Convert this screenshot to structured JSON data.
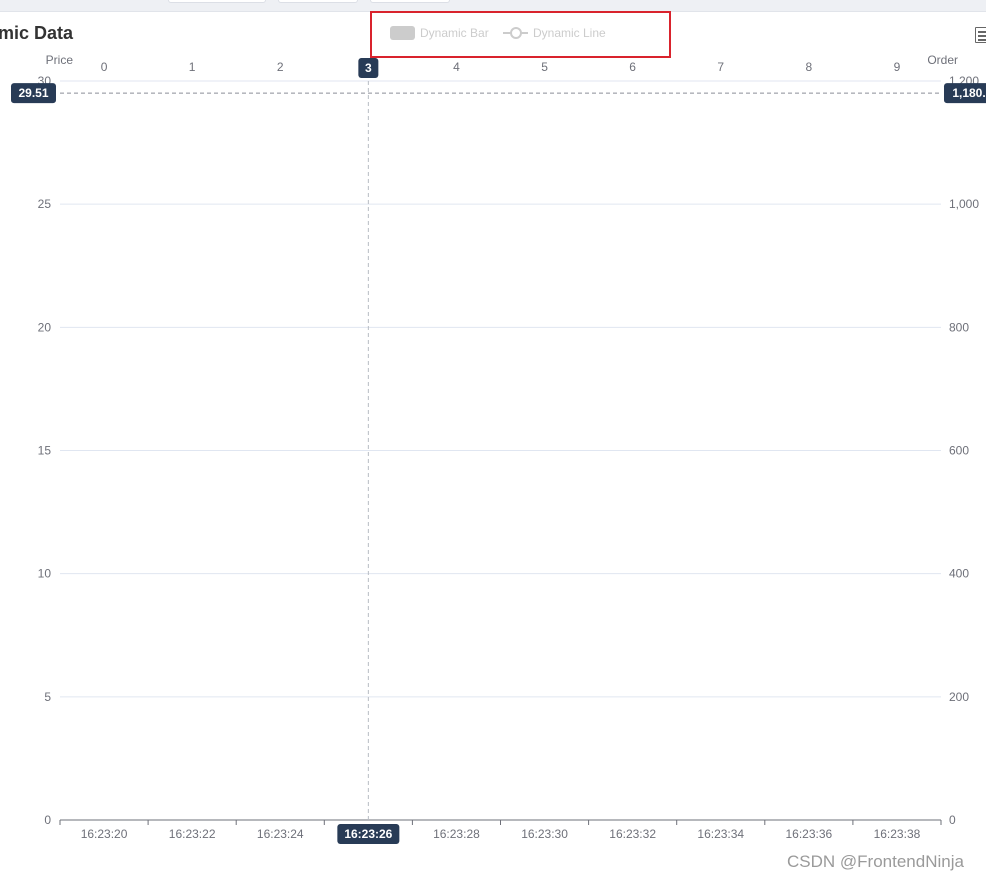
{
  "page": {
    "title": "mic Data",
    "watermark": "CSDN @FrontendNinja"
  },
  "legend": {
    "items": [
      {
        "label": "Dynamic Bar",
        "icon": "bar-swatch-icon",
        "state": "inactive"
      },
      {
        "label": "Dynamic Line",
        "icon": "line-swatch-icon",
        "state": "inactive"
      }
    ]
  },
  "toolbox": {
    "icon": "data-view-icon"
  },
  "colors": {
    "axis_label": "#6e7079",
    "grid": "#e0e6f1",
    "axis_line": "#6e7079",
    "pointer_label_bg": "#283b56",
    "pointer_label_text": "#ffffff",
    "pointer_line": "#b8bcc4",
    "legend_inactive": "#cccccc",
    "highlight": "#d9232d"
  },
  "chart_data": {
    "type": "bar",
    "x_time": {
      "position": "bottom",
      "categories": [
        "16:23:20",
        "16:23:22",
        "16:23:24",
        "16:23:26",
        "16:23:28",
        "16:23:30",
        "16:23:32",
        "16:23:34",
        "16:23:36",
        "16:23:38"
      ],
      "visible_labels": [
        "16:23:20",
        "16:23:22",
        "16:23:24",
        "16:23:2",
        "16:23:28",
        "16:23:30",
        "16:23:32",
        "16:23:34",
        "16:23:36",
        "16:23:38"
      ],
      "pointer_label": "16:23:26"
    },
    "x_index": {
      "position": "top",
      "categories": [
        "0",
        "1",
        "2",
        "3",
        "4",
        "5",
        "6",
        "7",
        "8",
        "9"
      ],
      "pointer_label": "3"
    },
    "y_left": {
      "name": "Price",
      "min": 0,
      "max": 30,
      "interval": 5,
      "ticks": [
        "0",
        "5",
        "10",
        "15",
        "20",
        "25",
        "30"
      ],
      "pointer_label": "29.51"
    },
    "y_right": {
      "name": "Order",
      "min": 0,
      "max": 1200,
      "interval": 200,
      "ticks": [
        "0",
        "200",
        "400",
        "600",
        "800",
        "1,000",
        "1,200"
      ],
      "pointer_label": "1,180."
    },
    "series": [
      {
        "name": "Dynamic Bar",
        "type": "bar",
        "values": [],
        "visible": false
      },
      {
        "name": "Dynamic Line",
        "type": "line",
        "values": [],
        "visible": false
      }
    ],
    "grid": true,
    "legend_position": "top-center",
    "axis_pointer": {
      "type": "cross",
      "category_index": 3,
      "left_value": 29.51
    }
  }
}
